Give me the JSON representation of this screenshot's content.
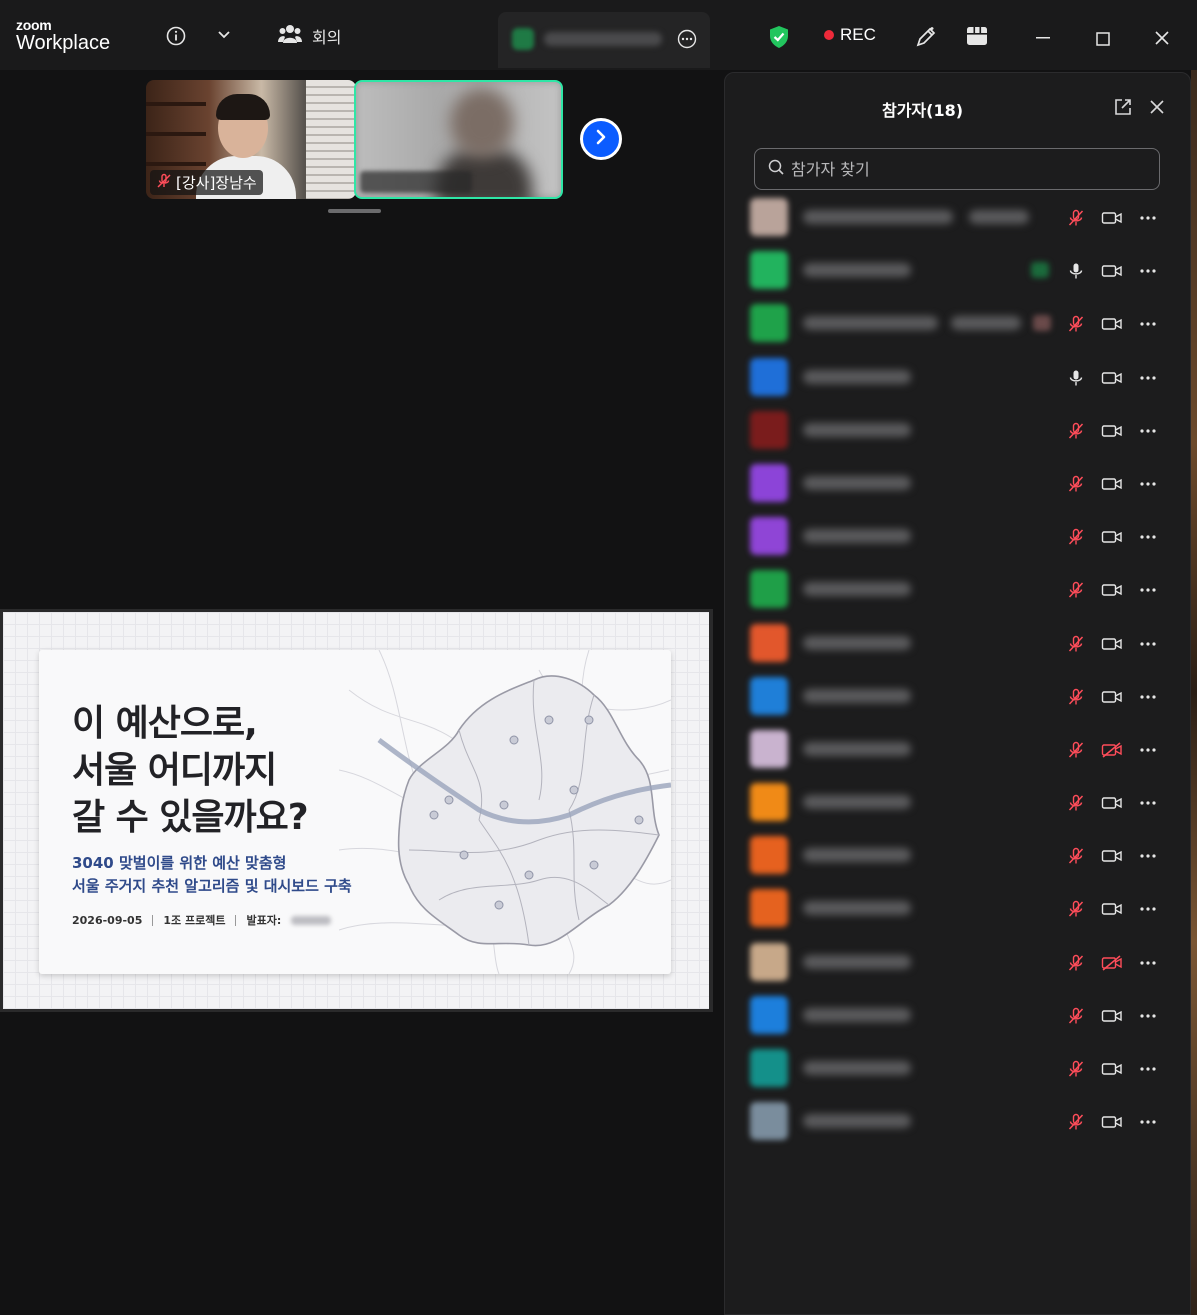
{
  "app": {
    "brand_top": "zoom",
    "brand_bottom": "Workplace"
  },
  "titlebar": {
    "meeting_label": "회의",
    "rec_label": "REC",
    "colors": {
      "rec_dot": "#ee2a3a",
      "shield": "#22c55e"
    }
  },
  "videos": {
    "thumb1_label": "[강사]장남수",
    "accent": "#2ee6a6",
    "next_button_color": "#0b5cff"
  },
  "slide": {
    "title": "이 예산으로, 서울 어디까지 갈 수 있을까요?",
    "subtitle_line1": "3040 맞벌이를 위한 예산 맞춤형",
    "subtitle_line2": "서울 주거지 추천 알고리즘 및 대시보드 구축",
    "date": "2026-09-05",
    "team": "1조 프로젝트",
    "presenter_label": "발표자:"
  },
  "participants_panel": {
    "title": "참가자(18)",
    "search_placeholder": "참가자 찾기",
    "rows": [
      {
        "avatar_color": "#b9a39a",
        "name_width": "medium",
        "mic": "muted",
        "camera": "on"
      },
      {
        "avatar_color": "#22b35e",
        "name_width": "short",
        "mic": "on",
        "camera": "on",
        "speaking": true
      },
      {
        "avatar_color": "#1fa24a",
        "name_width": "long",
        "mic": "muted",
        "camera": "on"
      },
      {
        "avatar_color": "#1f6fd8",
        "name_width": "short",
        "mic": "on",
        "camera": "on"
      },
      {
        "avatar_color": "#7a1c1c",
        "name_width": "short",
        "mic": "muted",
        "camera": "on"
      },
      {
        "avatar_color": "#8c44d8",
        "name_width": "short",
        "mic": "muted",
        "camera": "on"
      },
      {
        "avatar_color": "#8f45d6",
        "name_width": "short",
        "mic": "muted",
        "camera": "on"
      },
      {
        "avatar_color": "#1f9f48",
        "name_width": "short",
        "mic": "muted",
        "camera": "on"
      },
      {
        "avatar_color": "#e2572c",
        "name_width": "short",
        "mic": "muted",
        "camera": "on"
      },
      {
        "avatar_color": "#1f7fd8",
        "name_width": "short",
        "mic": "muted",
        "camera": "on"
      },
      {
        "avatar_color": "#c9b3cf",
        "name_width": "short",
        "mic": "muted",
        "camera": "off"
      },
      {
        "avatar_color": "#f08a17",
        "name_width": "short",
        "mic": "muted",
        "camera": "on"
      },
      {
        "avatar_color": "#e6611f",
        "name_width": "short",
        "mic": "muted",
        "camera": "on"
      },
      {
        "avatar_color": "#e5621f",
        "name_width": "short",
        "mic": "muted",
        "camera": "on"
      },
      {
        "avatar_color": "#c7a889",
        "name_width": "short",
        "mic": "muted",
        "camera": "off"
      },
      {
        "avatar_color": "#1d7fdc",
        "name_width": "short",
        "mic": "muted",
        "camera": "on"
      },
      {
        "avatar_color": "#14908a",
        "name_width": "short",
        "mic": "muted",
        "camera": "on"
      },
      {
        "avatar_color": "#7a8d9d",
        "name_width": "short",
        "mic": "muted",
        "camera": "on"
      }
    ]
  },
  "icons": [
    "info-icon",
    "chevron-down-icon",
    "people-icon",
    "more-icon",
    "shield-icon",
    "annotate-icon",
    "apps-icon",
    "minimize-icon",
    "maximize-icon",
    "close-icon",
    "mic-muted-icon",
    "camera-icon",
    "popout-icon",
    "search-icon"
  ]
}
